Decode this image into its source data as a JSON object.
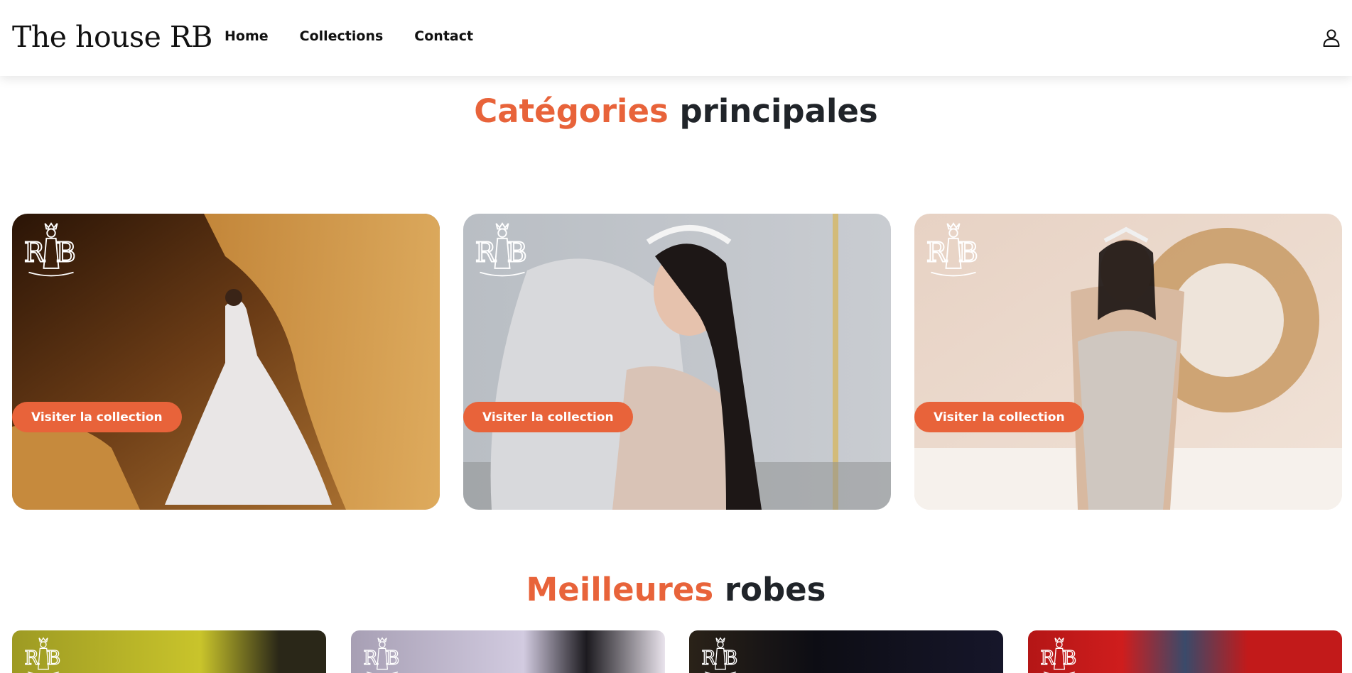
{
  "header": {
    "logo": "The house RB",
    "nav": [
      {
        "label": "Home"
      },
      {
        "label": "Collections"
      },
      {
        "label": "Contact"
      }
    ],
    "user_icon": "user-icon"
  },
  "categories": {
    "title_accent": "Catégories",
    "title_rest": "principales",
    "cards": [
      {
        "button_label": "Visiter la collection",
        "photo": "bride in ball gown by sandstone cliff",
        "watermark": "rb-monogram-logo"
      },
      {
        "button_label": "Visiter la collection",
        "photo": "bride with crystal tiara and veil",
        "watermark": "rb-monogram-logo"
      },
      {
        "button_label": "Visiter la collection",
        "photo": "bride in beaded corset gown by round mirror",
        "watermark": "rb-monogram-logo"
      }
    ]
  },
  "best": {
    "title_accent": "Meilleures",
    "title_rest": "robes",
    "items": [
      {
        "photo": "dress on yellow background",
        "watermark": "rb-monogram-logo"
      },
      {
        "photo": "dress on lavender background",
        "watermark": "rb-monogram-logo"
      },
      {
        "photo": "dress with chandelier on dark background",
        "watermark": "rb-monogram-logo"
      },
      {
        "photo": "dress on red curtain background",
        "watermark": "rb-monogram-logo"
      }
    ]
  },
  "colors": {
    "accent": "#e8633a",
    "heading": "#202429",
    "header_bg": "#ffffff"
  }
}
